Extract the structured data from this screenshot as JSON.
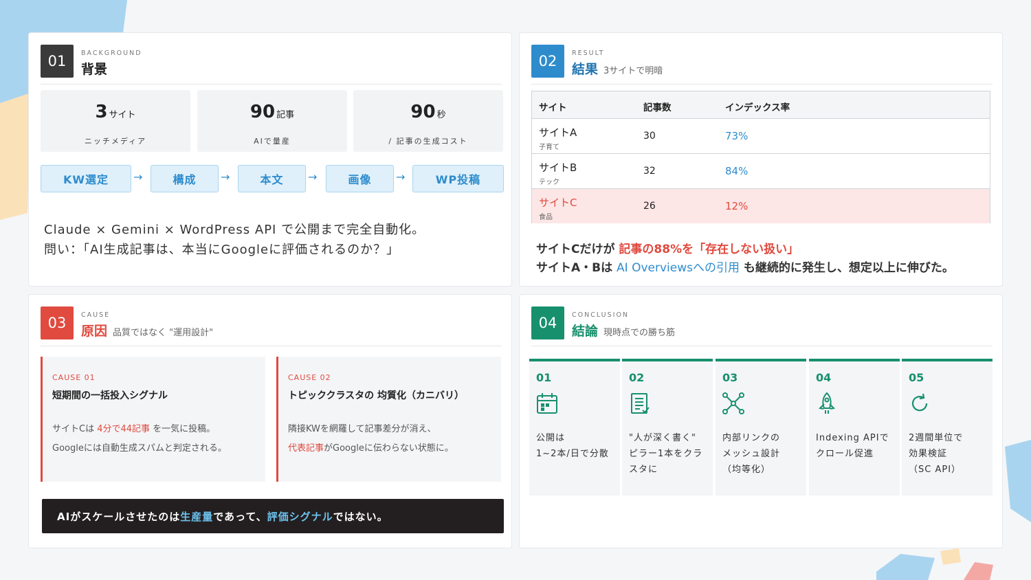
{
  "colors": {
    "background": "#f4f6f8",
    "accent_blue": "#2e8ccd",
    "accent_red": "#e04a3f",
    "accent_green": "#17906d",
    "dark_badge": "#3a3a3a",
    "dark_banner": "#231f20"
  },
  "card1": {
    "number": "01",
    "kicker": "BACKGROUND",
    "title": "背景",
    "stats": [
      {
        "num": "3",
        "unit": "サイト",
        "caption": "ニッチメディア"
      },
      {
        "num": "90",
        "unit": "記事",
        "caption": "AIで量産"
      },
      {
        "num": "90",
        "unit": "秒",
        "caption": "/ 記事の生成コスト"
      }
    ],
    "flow": [
      "KW選定",
      "構成",
      "本文",
      "画像",
      "WP投稿"
    ],
    "arrow": "→",
    "line1": "Claude × Gemini × WordPress API で公開まで完全自動化。",
    "line2": "問い：「AI生成記事は、本当にGoogleに評価されるのか？」"
  },
  "card2": {
    "number": "02",
    "kicker": "RESULT",
    "title": "結果",
    "subtitle": "3サイトで明暗",
    "table": {
      "headers": [
        "サイト",
        "記事数",
        "インデックス率"
      ],
      "rows": [
        {
          "site": "サイトA",
          "genre": "子育て",
          "count": "30",
          "rate": "73%"
        },
        {
          "site": "サイトB",
          "genre": "テック",
          "count": "32",
          "rate": "84%"
        },
        {
          "site": "サイトC",
          "genre": "食品",
          "count": "26",
          "rate": "12%"
        }
      ]
    },
    "summary1": {
      "a": "サイトCだけが ",
      "b": "記事の88%を「存在しない扱い」"
    },
    "summary2": {
      "a": "サイトA・Bは ",
      "b": "AI Overviewsへの引用",
      "c": " も継続的に発生し、想定以上に伸びた。"
    }
  },
  "card3": {
    "number": "03",
    "kicker": "CAUSE",
    "title": "原因",
    "subtitle": "品質ではなく \"運用設計\"",
    "causes": [
      {
        "label": "CAUSE 01",
        "title": "短期間の一括投入シグナル",
        "l1a": "サイトCは ",
        "l1b": "4分で44記事",
        "l1c": " を一気に投稿。",
        "l2": "Googleには自動生成スパムと判定される。"
      },
      {
        "label": "CAUSE 02",
        "title": "トピッククラスタの 均質化（カニバリ）",
        "l1a": "隣接KWを網羅して記事差分が消え、",
        "l2a": "代表記事",
        "l2b": "がGoogleに伝わらない状態に。"
      }
    ],
    "banner": {
      "a": "AIがスケールさせたのは ",
      "b": "生産量",
      "c": " であって、",
      "d": "評価シグナル",
      "e": " ではない。"
    }
  },
  "card4": {
    "number": "04",
    "kicker": "CONCLUSION",
    "title": "結論",
    "subtitle": "現時点での勝ち筋",
    "steps": [
      {
        "num": "01",
        "icon": "calendar-icon",
        "text": "公開は\n1~2本/日で分散"
      },
      {
        "num": "02",
        "icon": "document-icon",
        "text": "\"人が深く書く\"\nピラー1本をクラ\nスタに"
      },
      {
        "num": "03",
        "icon": "network-icon",
        "text": "内部リンクの\nメッシュ設計\n（均等化）"
      },
      {
        "num": "04",
        "icon": "rocket-icon",
        "text": "Indexing APIで\nクロール促進"
      },
      {
        "num": "05",
        "icon": "refresh-icon",
        "text": "2週間単位で\n効果検証\n（SC API）"
      }
    ]
  }
}
